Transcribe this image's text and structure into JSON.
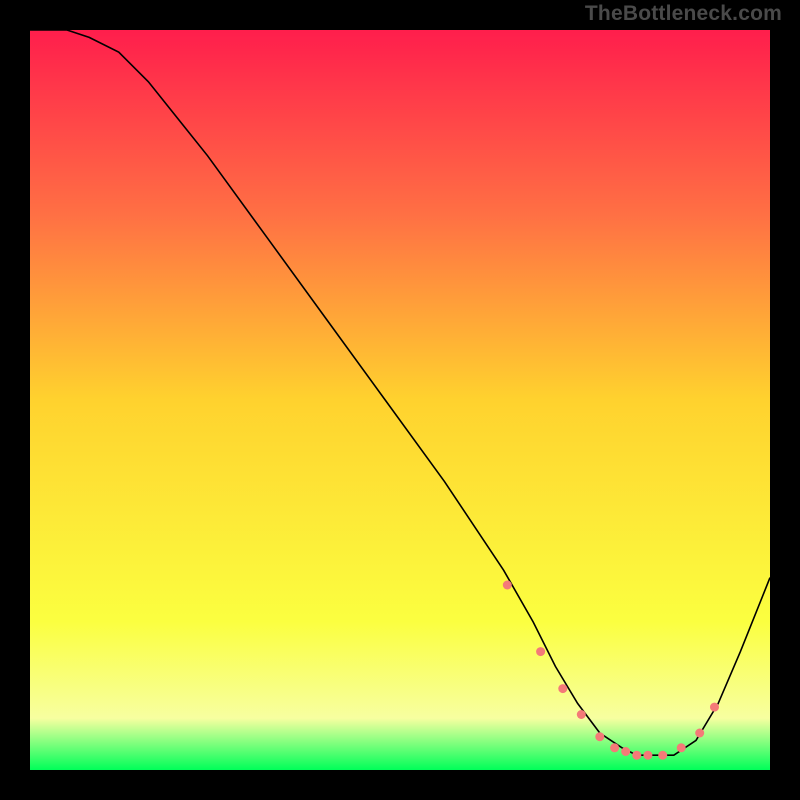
{
  "watermark": "TheBottleneck.com",
  "chart_data": {
    "type": "line",
    "title": "",
    "xlabel": "",
    "ylabel": "",
    "xlim": [
      0,
      100
    ],
    "ylim": [
      0,
      100
    ],
    "grid": false,
    "legend": false,
    "background_gradient": {
      "top_color": "#ff1e4c",
      "upper_mid_color": "#ff7044",
      "mid_color": "#ffd22e",
      "lower_mid_color": "#fbff40",
      "band_color": "#f7ffa0",
      "bottom_color": "#00ff59"
    },
    "series": [
      {
        "name": "bottleneck-curve",
        "stroke": "#000000",
        "stroke_width": 1.6,
        "x": [
          0,
          5,
          8,
          12,
          16,
          24,
          32,
          40,
          48,
          56,
          60,
          64,
          68,
          71,
          74,
          77,
          80,
          82,
          84,
          87,
          90,
          93,
          96,
          100
        ],
        "y": [
          100,
          100,
          99,
          97,
          93,
          83,
          72,
          61,
          50,
          39,
          33,
          27,
          20,
          14,
          9,
          5,
          3,
          2,
          2,
          2,
          4,
          9,
          16,
          26
        ]
      }
    ],
    "markers": {
      "name": "highlight-dots",
      "fill": "#f47a78",
      "radius": 4.5,
      "x": [
        64.5,
        69,
        72,
        74.5,
        77,
        79,
        80.5,
        82,
        83.5,
        85.5,
        88,
        90.5,
        92.5
      ],
      "y": [
        25,
        16,
        11,
        7.5,
        4.5,
        3,
        2.5,
        2,
        2,
        2,
        3,
        5,
        8.5
      ]
    }
  }
}
